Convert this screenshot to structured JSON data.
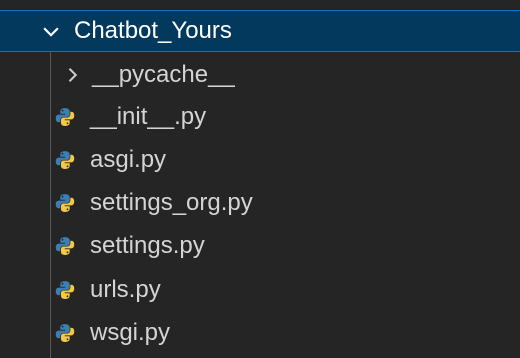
{
  "explorer": {
    "folder": {
      "name": "Chatbot_Yours",
      "icon": "chevron-down-icon",
      "expanded": true
    },
    "items": [
      {
        "type": "folder",
        "label": "__pycache__",
        "icon": "chevron-right-icon"
      },
      {
        "type": "file",
        "label": "__init__.py",
        "icon": "python-file-icon"
      },
      {
        "type": "file",
        "label": "asgi.py",
        "icon": "python-file-icon"
      },
      {
        "type": "file",
        "label": "settings_org.py",
        "icon": "python-file-icon"
      },
      {
        "type": "file",
        "label": "settings.py",
        "icon": "python-file-icon"
      },
      {
        "type": "file",
        "label": "urls.py",
        "icon": "python-file-icon"
      },
      {
        "type": "file",
        "label": "wsgi.py",
        "icon": "python-file-icon"
      }
    ]
  },
  "colors": {
    "background": "#252526",
    "selection": "#04395e",
    "selection_border": "#0a73c9",
    "python_blue": "#3c7fb5",
    "python_yellow": "#f6c945"
  }
}
